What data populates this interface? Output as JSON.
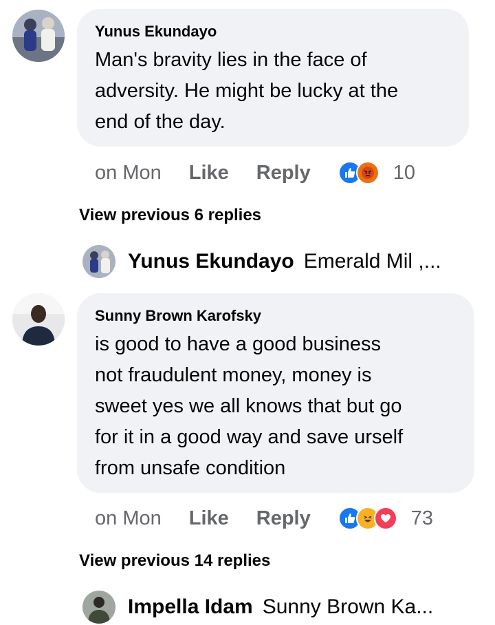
{
  "comments": [
    {
      "author": "Yunus Ekundayo",
      "text": "Man's bravity lies in the face of adversity. He might be lucky at the end of the day.",
      "lines": [
        "Man's bravity lies in the face of",
        "adversity. He might be lucky at the",
        "end of the day."
      ],
      "time": "on Mon",
      "like_label": "Like",
      "reply_label": "Reply",
      "reactions": [
        "like-icon",
        "angry-icon"
      ],
      "reaction_count": "10",
      "view_previous": "View previous 6 replies",
      "latest_reply": {
        "author": "Yunus Ekundayo",
        "snippet": "Emerald Mil ,..."
      }
    },
    {
      "author": "Sunny Brown Karofsky",
      "text": "is good to have a good business not fraudulent money, money is sweet yes we all knows that but go for it in a good way and save urself from unsafe condition",
      "lines": [
        "is good to have a good business",
        "not fraudulent money, money is",
        "sweet yes we all knows that but go",
        "for it in a good way and save urself",
        "from unsafe condition"
      ],
      "time": "on Mon",
      "like_label": "Like",
      "reply_label": "Reply",
      "reactions": [
        "like-icon",
        "haha-icon",
        "love-icon"
      ],
      "reaction_count": "73",
      "view_previous": "View previous 14 replies",
      "latest_reply": {
        "author": "Impella Idam",
        "snippet": "Sunny Brown Ka..."
      }
    }
  ],
  "colors": {
    "bubble": "#f0f2f5",
    "secondary_text": "#65676b",
    "like_blue": "#1877f2"
  }
}
